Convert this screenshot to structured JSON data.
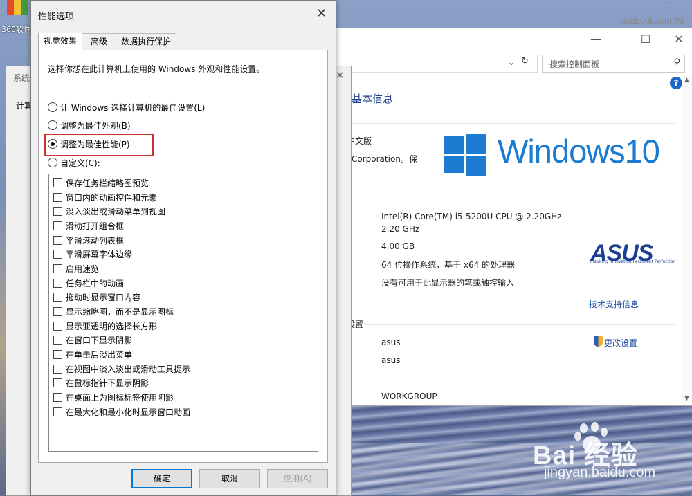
{
  "desktop": {
    "icon_label": "360软件",
    "corner_text_top": "...",
    "corner_text": "facebook.com/M"
  },
  "system_window": {
    "minimize": "—",
    "maximize": "☐",
    "close": "✕",
    "search_placeholder": "搜索控制面板",
    "help": "?",
    "heading": "基本信息",
    "edition_fragment": "中文版",
    "corp_fragment": "Corporation。保",
    "windows_brand": "Windows10",
    "cpu": "Intel(R) Core(TM) i5-5200U CPU @ 2.20GHz",
    "cpu_speed": "2.20 GHz",
    "ram_label_fragment": ":",
    "ram": "4.00 GB",
    "system_type": "64 位操作系统，基于 x64 的处理器",
    "pen_touch": "没有可用于此显示器的笔或触控输入",
    "asus_logo": "ASUS",
    "asus_tagline": "Inspiring Innovation  Persistent Perfection",
    "support_link": "技术支持信息",
    "settings_fragment": "设置",
    "computer_name": "asus",
    "full_name": "asus",
    "change_settings": "更改设置",
    "workgroup": "WORKGROUP"
  },
  "sysprop_window": {
    "title_fragment": "系统",
    "tab_fragment": "计算"
  },
  "dialog": {
    "title": "性能选项",
    "close": "✕",
    "tabs": [
      "视觉效果",
      "高级",
      "数据执行保护"
    ],
    "description": "选择你想在此计算机上使用的 Windows 外观和性能设置。",
    "radios": [
      {
        "label": "让 Windows 选择计算机的最佳设置(L)",
        "selected": false
      },
      {
        "label": "调整为最佳外观(B)",
        "selected": false
      },
      {
        "label": "调整为最佳性能(P)",
        "selected": true
      },
      {
        "label": "自定义(C):",
        "selected": false
      }
    ],
    "checkboxes": [
      "保存任务栏缩略图预览",
      "窗口内的动画控件和元素",
      "淡入淡出或滑动菜单到视图",
      "滑动打开组合框",
      "平滑滚动列表框",
      "平滑屏幕字体边缘",
      "启用速览",
      "任务栏中的动画",
      "拖动时显示窗口内容",
      "显示缩略图，而不是显示图标",
      "显示亚透明的选择长方形",
      "在窗口下显示阴影",
      "在单击后淡出菜单",
      "在视图中淡入淡出或滑动工具提示",
      "在鼠标指针下显示阴影",
      "在桌面上为图标标签使用阴影",
      "在最大化和最小化时显示窗口动画"
    ],
    "buttons": {
      "ok": "确定",
      "cancel": "取消",
      "apply": "应用(A)"
    }
  },
  "watermark": {
    "brand": "Bai  经验",
    "url": "jingyan.baidu.com"
  },
  "colors": {
    "highlight_box": "#c8342c",
    "windows_blue": "#1b7bd0",
    "asus_blue": "#1c3f93",
    "link_blue": "#1e4fa8"
  }
}
